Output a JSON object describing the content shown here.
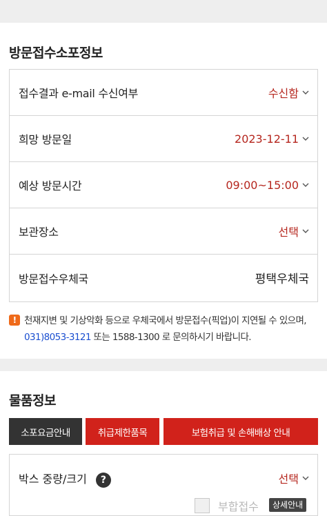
{
  "visit_section": {
    "title": "방문접수소포정보",
    "rows": [
      {
        "label": "접수결과 e-mail 수신여부",
        "value": "수신함"
      },
      {
        "label": "희망 방문일",
        "value": "2023-12-11"
      },
      {
        "label": "예상 방문시간",
        "value": "09:00~15:00"
      },
      {
        "label": "보관장소",
        "value": "선택"
      },
      {
        "label": "방문접수우체국",
        "value": "평택우체국"
      }
    ]
  },
  "notice": {
    "icon": "!",
    "text_before": "천재지변 및 기상악화 등으로 우체국에서 방문접수(픽업)이 지연될 수 있으며, ",
    "phone": "031)8053-3121",
    "text_after": " 또는 1588-1300 로 문의하시기 바랍니다."
  },
  "goods_section": {
    "title": "물품정보",
    "buttons": [
      "소포요금안내",
      "취급제한품목",
      "보험취급 및 손해배상 안내"
    ],
    "box_label": "박스 중량/크기",
    "box_help": "?",
    "box_value": "선택",
    "combine_label": "부합접수",
    "detail_label": "상세안내"
  },
  "colors": {
    "accent_red": "#d1221b",
    "value_red": "#b5261e",
    "dark_button": "#333333",
    "phone_blue": "#1b4fd0"
  }
}
